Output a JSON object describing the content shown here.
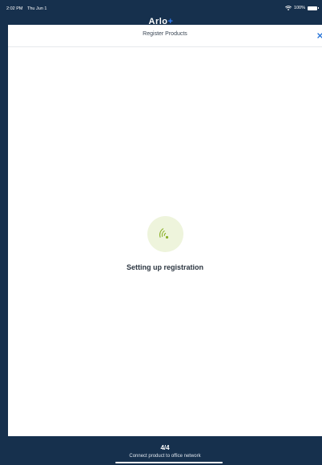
{
  "status_bar": {
    "time": "2:02 PM",
    "date": "Thu Jun 1",
    "battery": "100%",
    "wifi_icon": "wifi-icon",
    "battery_icon": "battery-icon"
  },
  "app": {
    "logo_main": "Arlo",
    "logo_accent": "+"
  },
  "sheet": {
    "title": "Register Products",
    "close_icon": "close-icon"
  },
  "loader": {
    "icon": "signal-icon",
    "text": "Setting up registration"
  },
  "footer": {
    "step": "4/4",
    "label": "Connect product to office network"
  },
  "colors": {
    "navy": "#16304d",
    "accent_blue": "#2e7bf6",
    "loader_green": "#8cb02a",
    "loader_bg": "#eef4dc"
  }
}
